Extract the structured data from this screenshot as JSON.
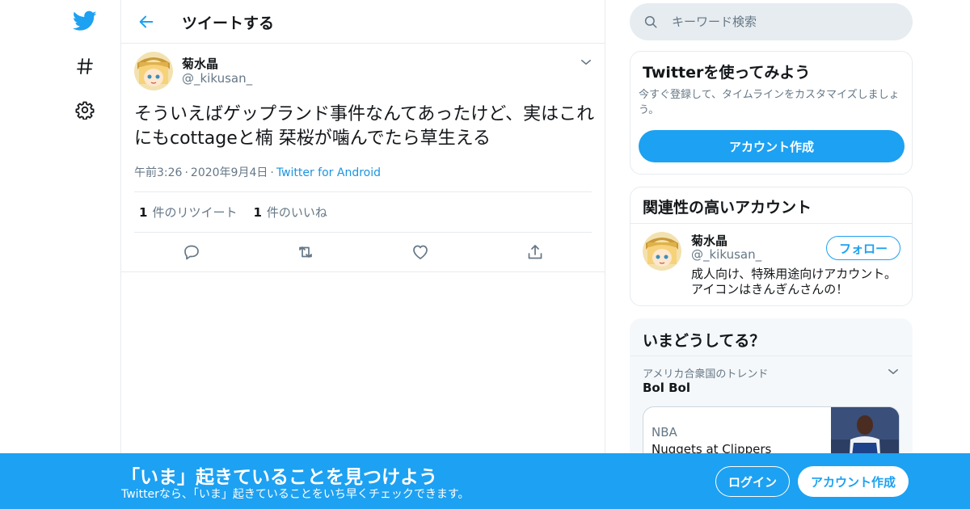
{
  "colors": {
    "accent": "#1da1f2",
    "text": "#14171a",
    "muted": "#657786",
    "border": "#e6ecf0"
  },
  "nav": {
    "items": [
      {
        "icon": "twitter-bird-icon"
      },
      {
        "icon": "hashtag-icon"
      },
      {
        "icon": "gear-icon"
      }
    ]
  },
  "header": {
    "title": "ツイートする"
  },
  "tweet": {
    "author_name": "菊水晶",
    "author_handle": "@_kikusan_",
    "text": "そういえばゲップランド事件なんてあったけど、実はこれにもcottageと楠 栞桜が噛んでたら草生える",
    "time": "午前3:26",
    "date": "2020年9月4日",
    "source": "Twitter for Android",
    "retweet_count": "1",
    "retweet_label": "件のリツイート",
    "like_count": "1",
    "like_label": "件のいいね"
  },
  "search": {
    "placeholder": "キーワード検索"
  },
  "signup_card": {
    "title": "Twitterを使ってみよう",
    "subtitle": "今すぐ登録して、タイムラインをカスタマイズしましょう。",
    "button": "アカウント作成"
  },
  "related": {
    "title": "関連性の高いアカウント",
    "name": "菊水晶",
    "handle": "@_kikusan_",
    "follow": "フォロー",
    "bio": "成人向け、特殊用途向けアカウント。アイコンはきんぎんさんの！"
  },
  "trends": {
    "title": "いまどうしてる？",
    "context": "アメリカ合衆国のトレンド",
    "name": "Bol Bol",
    "news_category": "NBA",
    "news_title": "Nuggets at Clippers"
  },
  "banner": {
    "title": "「いま」起きていることを見つけよう",
    "subtitle": "Twitterなら、「いま」起きていることをいち早くチェックできます。",
    "login": "ログイン",
    "signup": "アカウント作成"
  }
}
